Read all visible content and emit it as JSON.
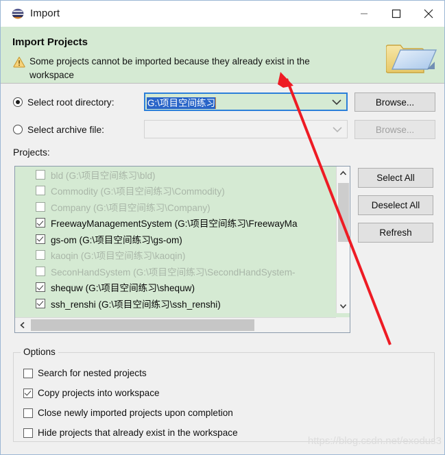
{
  "window": {
    "title": "Import",
    "icon": "eclipse-icon",
    "minimize_label": "—",
    "maximize_label": "□",
    "close_label": "✕"
  },
  "banner": {
    "title": "Import Projects",
    "message": "Some projects cannot be imported because they already exist in the workspace",
    "icon": "warning-icon",
    "graphic": "folder-icon",
    "bg_color": "#d5ead3"
  },
  "source": {
    "root_directory": {
      "label": "Select root directory:",
      "selected": true,
      "value": "G:\\项目空间练习",
      "browse_label": "Browse...",
      "browse_enabled": true
    },
    "archive_file": {
      "label": "Select archive file:",
      "selected": false,
      "value": "",
      "browse_label": "Browse...",
      "browse_enabled": false
    }
  },
  "projects": {
    "label": "Projects:",
    "items": [
      {
        "name": "bld (G:\\项目空间练习\\bld)",
        "checked": false,
        "enabled": false
      },
      {
        "name": "Commodity (G:\\项目空间练习\\Commodity)",
        "checked": false,
        "enabled": false
      },
      {
        "name": "Company (G:\\项目空间练习\\Company)",
        "checked": false,
        "enabled": false
      },
      {
        "name": "FreewayManagementSystem (G:\\项目空间练习\\FreewayMa",
        "checked": true,
        "enabled": true
      },
      {
        "name": "gs-om (G:\\项目空间练习\\gs-om)",
        "checked": true,
        "enabled": true
      },
      {
        "name": "kaoqin (G:\\项目空间练习\\kaoqin)",
        "checked": false,
        "enabled": false
      },
      {
        "name": "SeconHandSystem (G:\\项目空间练习\\SecondHandSystem-",
        "checked": false,
        "enabled": false
      },
      {
        "name": "shequw (G:\\项目空间练习\\shequw)",
        "checked": true,
        "enabled": true
      },
      {
        "name": "ssh_renshi (G:\\项目空间练习\\ssh_renshi)",
        "checked": true,
        "enabled": true
      }
    ],
    "buttons": {
      "select_all": "Select All",
      "deselect_all": "Deselect All",
      "refresh": "Refresh"
    }
  },
  "options": {
    "legend": "Options",
    "items": [
      {
        "label": "Search for nested projects",
        "checked": false
      },
      {
        "label": "Copy projects into workspace",
        "checked": true
      },
      {
        "label": "Close newly imported projects upon completion",
        "checked": false
      },
      {
        "label": "Hide projects that already exist in the workspace",
        "checked": false
      }
    ]
  },
  "annotation": {
    "arrow_color": "#ee1b24"
  },
  "watermark": {
    "text": "https://blog.csdn.net/exodus3"
  }
}
